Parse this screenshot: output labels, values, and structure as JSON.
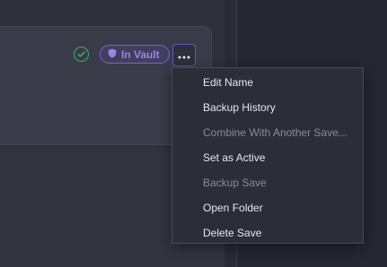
{
  "card": {
    "vault_badge": "In Vault",
    "status_icon": "check-circle-icon",
    "badge_icon": "shield-icon",
    "more_icon": "ellipsis-icon"
  },
  "menu": {
    "items": [
      {
        "label": "Edit Name",
        "enabled": true
      },
      {
        "label": "Backup History",
        "enabled": true
      },
      {
        "label": "Combine With Another Save...",
        "enabled": false
      },
      {
        "label": "Set as Active",
        "enabled": true
      },
      {
        "label": "Backup Save",
        "enabled": false
      },
      {
        "label": "Open Folder",
        "enabled": true
      },
      {
        "label": "Delete Save",
        "enabled": true
      }
    ]
  },
  "colors": {
    "accent": "#7a5fd9",
    "success": "#3fae6e"
  }
}
